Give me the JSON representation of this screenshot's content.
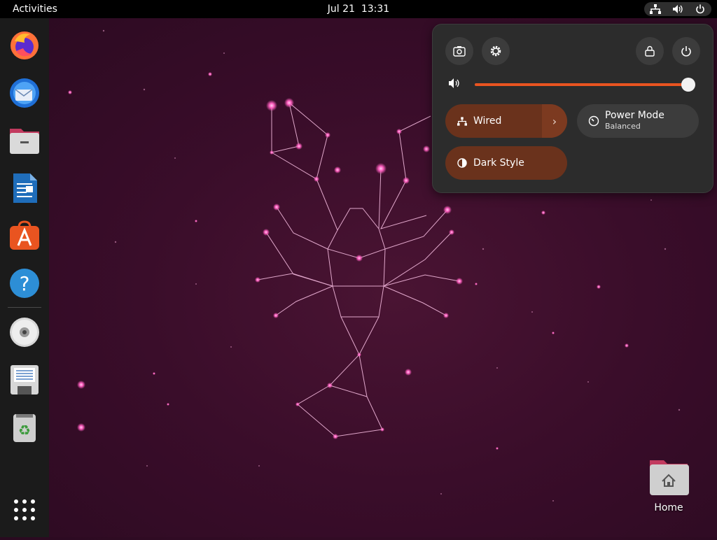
{
  "topbar": {
    "activities_label": "Activities",
    "date": "Jul 21",
    "time": "13:31",
    "tray_icons": [
      "network-wired-icon",
      "speaker-icon",
      "power-icon"
    ]
  },
  "dock": {
    "items": [
      {
        "name": "firefox-icon"
      },
      {
        "name": "thunderbird-icon"
      },
      {
        "name": "files-icon"
      },
      {
        "name": "libreoffice-writer-icon"
      },
      {
        "name": "app-center-icon"
      },
      {
        "name": "help-icon"
      },
      {
        "name": "disc-icon"
      },
      {
        "name": "floppy-installer-icon"
      },
      {
        "name": "trash-icon"
      },
      {
        "name": "show-apps-grid-icon"
      }
    ]
  },
  "quick_settings": {
    "buttons": [
      "screenshot-icon",
      "settings-icon",
      "lock-icon",
      "power-icon"
    ],
    "volume": {
      "icon": "speaker-icon",
      "level": 0.998
    },
    "wired": {
      "label": "Wired",
      "active": true
    },
    "power_mode": {
      "title": "Power Mode",
      "subtitle": "Balanced",
      "active": false
    },
    "dark_style": {
      "label": "Dark Style",
      "active": true
    }
  },
  "desktop": {
    "home_label": "Home"
  },
  "colors": {
    "accent": "#e95420",
    "active_pill": "#6a321c",
    "panel_bg": "#2c2c2c",
    "wallpaper": "#3a0d2a"
  }
}
